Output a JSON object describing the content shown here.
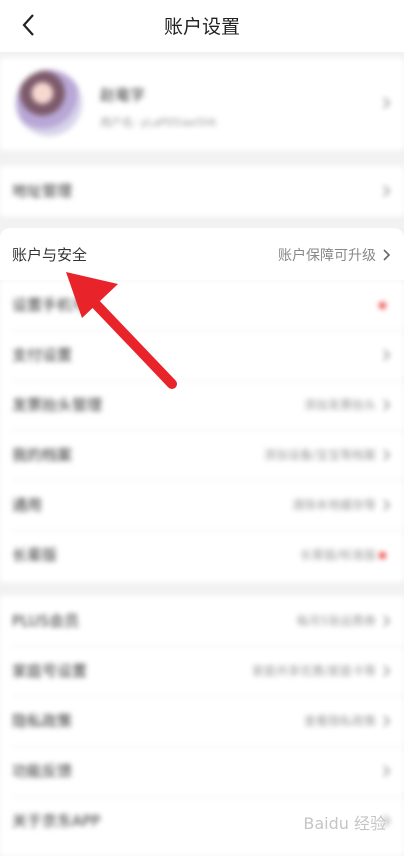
{
  "header": {
    "title": "账户设置",
    "back_icon": "chevron-left-icon"
  },
  "profile": {
    "name": "赵竜字",
    "user_id": "用户名: yLaP05iae5Ht"
  },
  "rows_top": [
    {
      "label": "地址管理",
      "value": ""
    }
  ],
  "account_security": {
    "label": "账户与安全",
    "value": "账户保障可升级"
  },
  "rows_middle": [
    {
      "label": "设置手机号",
      "value": "",
      "dot": true
    },
    {
      "label": "支付设置",
      "value": ""
    },
    {
      "label": "发票抬头管理",
      "value": "添加发票抬头"
    },
    {
      "label": "我的档案",
      "value": "添加设备/宝宝等档案"
    },
    {
      "label": "通用",
      "value": "清除本地缓存等"
    },
    {
      "label": "长辈版",
      "value": "长辈版/标准版",
      "dot": true
    }
  ],
  "rows_bottom": [
    {
      "label": "PLUS会员",
      "value": "每月5张运费券"
    },
    {
      "label": "家庭号设置",
      "value": "家庭共享优惠/家庭卡等"
    },
    {
      "label": "隐私政策",
      "value": "查看隐私政策"
    },
    {
      "label": "功能反馈",
      "value": ""
    },
    {
      "label": "关于京东APP",
      "value": ""
    }
  ],
  "watermark": "Baidu 经验",
  "colors": {
    "arrow": "#e8242a",
    "badge": "#e9413a"
  }
}
